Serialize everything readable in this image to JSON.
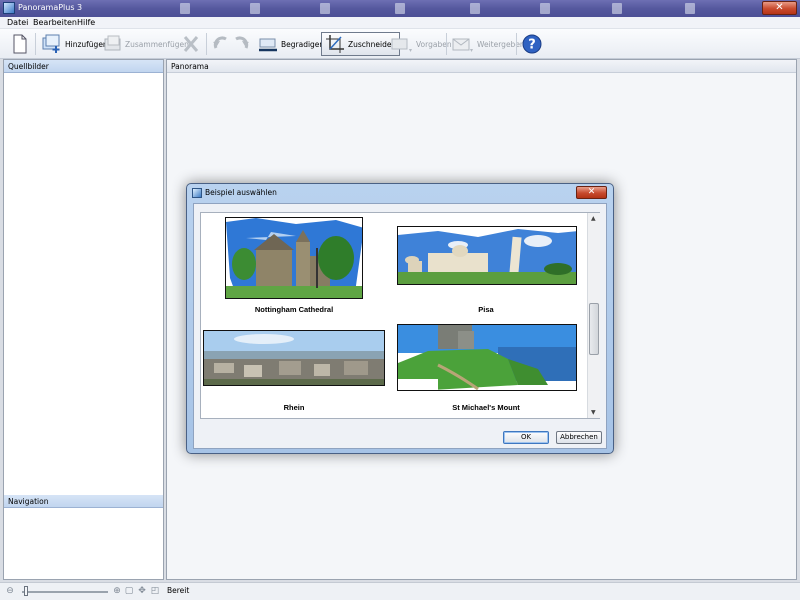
{
  "window": {
    "title": "PanoramaPlus 3",
    "close_symbol": "✕"
  },
  "menu": [
    "Datei",
    "Bearbeiten",
    "Hilfe"
  ],
  "toolbar": {
    "add": "Hinzufügen",
    "merge": "Zusammenfügen",
    "straighten": "Begradigen",
    "crop": "Zuschneiden",
    "presets": "Vorgaben",
    "share": "Weitergeben"
  },
  "panes": {
    "source": "Quellbilder",
    "panorama": "Panorama",
    "navigation": "Navigation"
  },
  "status": {
    "text": "Bereit",
    "zoom_slider_level": 0.02
  },
  "dialog": {
    "title": "Beispiel auswählen",
    "close_symbol": "✕",
    "examples": [
      {
        "name": "Nottingham Cathedral"
      },
      {
        "name": "Pisa"
      },
      {
        "name": "Rhein"
      },
      {
        "name": "St Michael's Mount"
      }
    ],
    "scroll_arrows": {
      "up": "▲",
      "down": "▼"
    },
    "ok": "OK",
    "cancel": "Abbrechen"
  },
  "colors": {
    "titlebar": "#55589e",
    "pane_header": "#c1d5ef",
    "dialog_frame": "#a6c3e6",
    "close_red": "#c94b2f"
  }
}
